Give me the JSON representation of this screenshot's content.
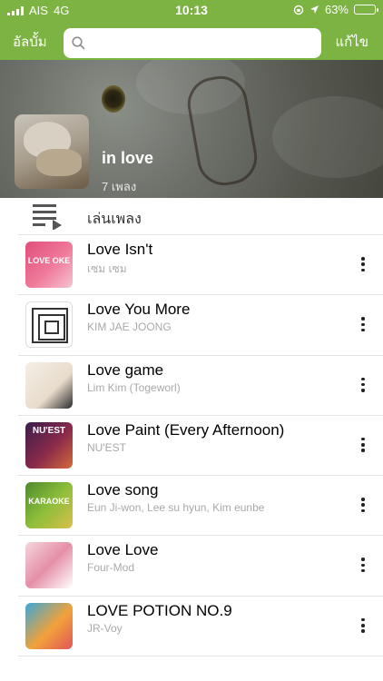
{
  "status": {
    "carrier": "AIS",
    "network": "4G",
    "time": "10:13",
    "battery": "63%",
    "battery_level": 0.63
  },
  "nav": {
    "back_label": "อัลบั้ม",
    "edit_label": "แก้ไข",
    "search_placeholder": "",
    "icons": [
      "search-icon"
    ]
  },
  "album": {
    "title": "in love",
    "count": "7 เพลง"
  },
  "play_all": {
    "label": "เล่นเพลง",
    "icon": "playlist-play-icon"
  },
  "songs": [
    {
      "title": "Love Isn't",
      "artist": "เซม เซม",
      "art": "LOVE OKE"
    },
    {
      "title": "Love You More",
      "artist": "KIM JAE JOONG",
      "art": ""
    },
    {
      "title": "Love game",
      "artist": "Lim Kim (Togeworl)",
      "art": ""
    },
    {
      "title": "Love Paint (Every Afternoon)",
      "artist": "NU'EST",
      "art": "NU'EST"
    },
    {
      "title": "Love song",
      "artist": "Eun Ji-won, Lee su hyun, Kim eunbe",
      "art": "KARAOKE"
    },
    {
      "title": "Love Love",
      "artist": "Four-Mod",
      "art": ""
    },
    {
      "title": "LOVE POTION NO.9",
      "artist": "JR-Voy",
      "art": ""
    }
  ],
  "colors": {
    "accent": "#7cb342",
    "text": "#000000",
    "secondary_text": "#a9a9a9"
  }
}
